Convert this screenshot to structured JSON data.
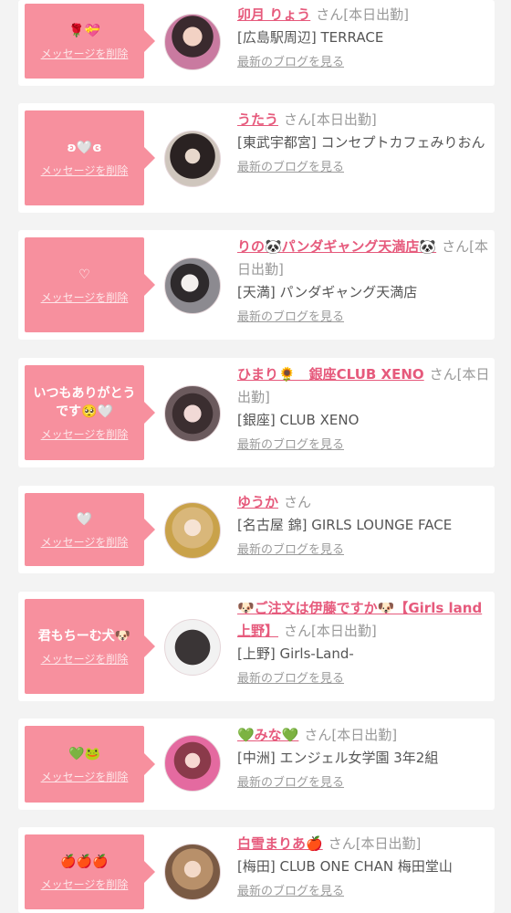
{
  "delete_label": "メッセージを削除",
  "blog_label": "最新のブログを見る",
  "entries": [
    {
      "message": "🌹💝",
      "name": "卯月 りょう",
      "suffix": "さん[本日出勤]",
      "shop": "[広島駅周辺] TERRACE"
    },
    {
      "message": "ʚ🤍ɞ",
      "name": "うたう",
      "suffix": "さん[本日出勤]",
      "shop": "[東武宇都宮] コンセプトカフェみりおん"
    },
    {
      "message": "♡",
      "name": "りの🐼パンダギャング天満店🐼",
      "suffix": "さん[本日出勤]",
      "shop": "[天満] パンダギャング天満店"
    },
    {
      "message": "いつもありがとうです🥺🤍",
      "name": "ひまり🌻　銀座CLUB XENO",
      "suffix": "さん[本日出勤]",
      "shop": "[銀座] CLUB XENO"
    },
    {
      "message": "🤍",
      "name": "ゆうか",
      "suffix": "さん",
      "shop": "[名古屋 錦] GIRLS LOUNGE FACE"
    },
    {
      "message": "君もちーむ犬🐶",
      "name": "🐶ご注文は伊藤ですか🐶【Girls land上野】",
      "suffix": "さん[本日出勤]",
      "shop": "[上野] Girls-Land-"
    },
    {
      "message": "💚🐸",
      "name": "💚みな💚",
      "suffix": "さん[本日出勤]",
      "shop": "[中洲] エンジェル女学園 3年2組"
    },
    {
      "message": "🍎🍎🍎",
      "name": "白雪まりあ🍎",
      "suffix": "さん[本日出勤]",
      "shop": "[梅田] CLUB ONE CHAN 梅田堂山"
    }
  ]
}
